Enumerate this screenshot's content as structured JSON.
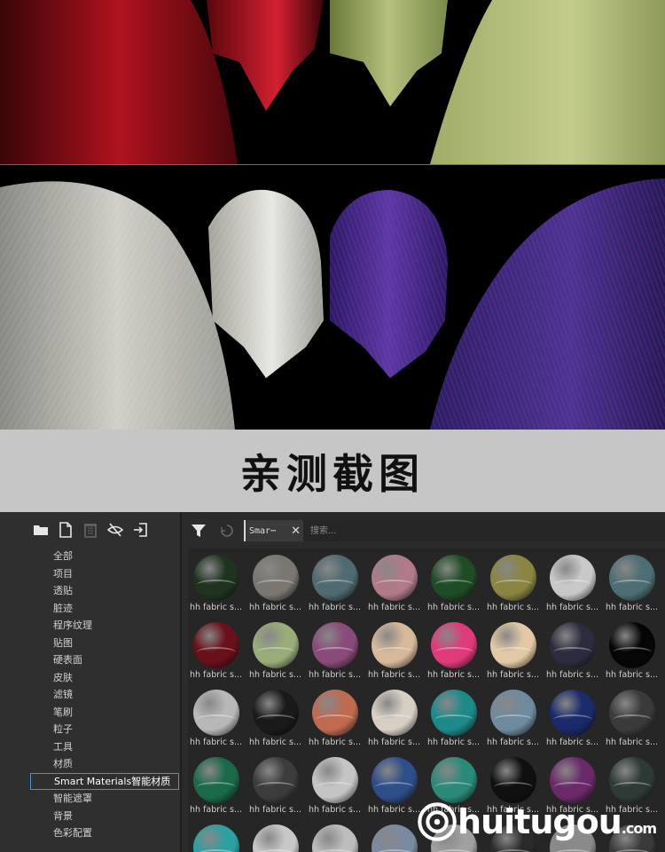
{
  "caption": "亲测截图",
  "toolbar_left_icons": [
    "folder-icon",
    "new-file-icon",
    "trash-icon",
    "hide-icon",
    "import-icon"
  ],
  "categories": [
    {
      "label": "全部"
    },
    {
      "label": "项目"
    },
    {
      "label": "透贴"
    },
    {
      "label": "脏迹"
    },
    {
      "label": "程序纹理"
    },
    {
      "label": "贴图"
    },
    {
      "label": "硬表面"
    },
    {
      "label": "皮肤"
    },
    {
      "label": "滤镜"
    },
    {
      "label": "笔刷"
    },
    {
      "label": "粒子"
    },
    {
      "label": "工具"
    },
    {
      "label": "材质"
    },
    {
      "label": "Smart Materials智能材质",
      "active": true
    },
    {
      "label": "智能遮罩"
    },
    {
      "label": "背景"
    },
    {
      "label": "色彩配置"
    }
  ],
  "filter_tab": {
    "label": "Smar⋯",
    "close": "✕"
  },
  "search": {
    "placeholder": "搜索..."
  },
  "materials": [
    {
      "label": "hh fabric s...",
      "color": "#1f3320"
    },
    {
      "label": "hh fabric s...",
      "color": "#7a7670"
    },
    {
      "label": "hh fabric s...",
      "color": "#4f6a70"
    },
    {
      "label": "hh fabric s...",
      "color": "#b07a88"
    },
    {
      "label": "hh fabric s...",
      "color": "#1e4d25"
    },
    {
      "label": "hh fabric s...",
      "color": "#8a8540"
    },
    {
      "label": "hh fabric s...",
      "color": "#c8c8c8"
    },
    {
      "label": "hh fabric s...",
      "color": "#4d6e74"
    },
    {
      "label": "hh fabric s...",
      "color": "#6a101a"
    },
    {
      "label": "hh fabric s...",
      "color": "#9aac78"
    },
    {
      "label": "hh fabric s...",
      "color": "#8a4a7a"
    },
    {
      "label": "hh fabric s...",
      "color": "#d6b89a"
    },
    {
      "label": "hh fabric s...",
      "color": "#e03a7a"
    },
    {
      "label": "hh fabric s...",
      "color": "#e2c8a4"
    },
    {
      "label": "hh fabric s...",
      "color": "#2c2c40"
    },
    {
      "label": "hh fabric s...",
      "color": "#050505"
    },
    {
      "label": "hh fabric s...",
      "color": "#b8b8b8"
    },
    {
      "label": "hh fabric s...",
      "color": "#1a1a1a"
    },
    {
      "label": "hh fabric s...",
      "color": "#c06a50"
    },
    {
      "label": "hh fabric s...",
      "color": "#d8cfc4"
    },
    {
      "label": "hh fabric s...",
      "color": "#1d8a8a"
    },
    {
      "label": "hh fabric s...",
      "color": "#6e8a9e"
    },
    {
      "label": "hh fabric s...",
      "color": "#1a2a6a"
    },
    {
      "label": "hh fabric s...",
      "color": "#3a3a3a"
    },
    {
      "label": "hh fabric s...",
      "color": "#1a6a4a"
    },
    {
      "label": "hh fabric s...",
      "color": "#3c3c3c"
    },
    {
      "label": "hh fabric s...",
      "color": "#c4c4c4"
    },
    {
      "label": "hh fabric s...",
      "color": "#2e4e8a"
    },
    {
      "label": "hh fabric s...",
      "color": "#2a8a7a"
    },
    {
      "label": "hh fabric s...",
      "color": "#101010"
    },
    {
      "label": "hh fabric s...",
      "color": "#6a2a6a"
    },
    {
      "label": "hh fabric s...",
      "color": "#2e3a36"
    },
    {
      "label": "",
      "color": "#2aa0a0"
    },
    {
      "label": "",
      "color": "#c8c8c8"
    },
    {
      "label": "",
      "color": "#bdbdbd"
    },
    {
      "label": "",
      "color": "#7a8aa0"
    },
    {
      "label": "",
      "color": "#a0a0a0"
    },
    {
      "label": "",
      "color": "#2a2a2a"
    },
    {
      "label": "",
      "color": "#8a8a8a"
    },
    {
      "label": "",
      "color": "#3a3a3a"
    }
  ],
  "watermark": {
    "main": "huitugou",
    "suffix": ".com"
  }
}
